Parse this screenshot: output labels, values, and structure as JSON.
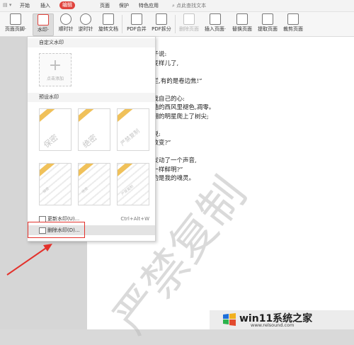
{
  "menubar": {
    "items": [
      "开始",
      "插入",
      "编辑",
      "页面",
      "保护",
      "特色应用"
    ],
    "active_index": 2,
    "search_label": "点此查找文本"
  },
  "ribbon": {
    "buttons": [
      {
        "label": "页面页脚·",
        "icon": "header-footer-icon",
        "disabled": false,
        "selected": false
      },
      {
        "label": "水印·",
        "icon": "watermark-icon",
        "disabled": false,
        "selected": true
      },
      {
        "label": "顺时针",
        "icon": "rotate-clockwise-icon",
        "disabled": false,
        "selected": false
      },
      {
        "label": "逆时针",
        "icon": "rotate-counterclockwise-icon",
        "disabled": false,
        "selected": false
      },
      {
        "label": "旋转文档",
        "icon": "rotate-document-icon",
        "disabled": false,
        "selected": false
      },
      {
        "label": "PDF合并",
        "icon": "pdf-merge-icon",
        "disabled": false,
        "selected": false
      },
      {
        "label": "PDF拆分",
        "icon": "pdf-split-icon",
        "disabled": false,
        "selected": false
      },
      {
        "label": "删除页面",
        "icon": "delete-page-icon",
        "disabled": true,
        "selected": false
      },
      {
        "label": "插入页面·",
        "icon": "insert-page-icon",
        "disabled": false,
        "selected": false
      },
      {
        "label": "替换页面",
        "icon": "replace-page-icon",
        "disabled": false,
        "selected": false
      },
      {
        "label": "提取页面",
        "icon": "extract-page-icon",
        "disabled": false,
        "selected": false
      },
      {
        "label": "裁剪页面",
        "icon": "crop-page-icon",
        "disabled": false,
        "selected": false
      }
    ]
  },
  "dropdown": {
    "custom_header": "自定义水印",
    "custom_add_label": "点击添加",
    "preset_header": "预设水印",
    "presets": [
      {
        "text": "保密"
      },
      {
        "text": "绝密"
      },
      {
        "text": "严禁复制"
      },
      {
        "text": "保密"
      },
      {
        "text": "绝密"
      },
      {
        "text": "严禁复制"
      }
    ],
    "update_label": "更新水印(U)...",
    "update_shortcut": "Ctrl+Alt+W",
    "delete_label": "删除水印(D)..."
  },
  "document": {
    "lines": [
      "对子说:",
      "又变样儿了,",
      "",
      "心烂,有的是卷边焦!”",
      "是,",
      "是我自己的心:",
      "冷酷的西风里褪色,凋零。",
      "经翻的明星爬上了树尖;",
      "它,",
      "见说:",
      "可改变?”",
      "儿,",
      "又发动了一个声音,",
      "是一样鲜明?”",
      "话的是我的魂灵。"
    ],
    "watermark_text": "严禁复制"
  },
  "logo": {
    "title": "win11系统之家",
    "url": "www.relsound.com"
  },
  "colors": {
    "accent_red": "#e0443e",
    "highlight_red": "#e3312b",
    "preset_corner": "#f0c15a"
  }
}
